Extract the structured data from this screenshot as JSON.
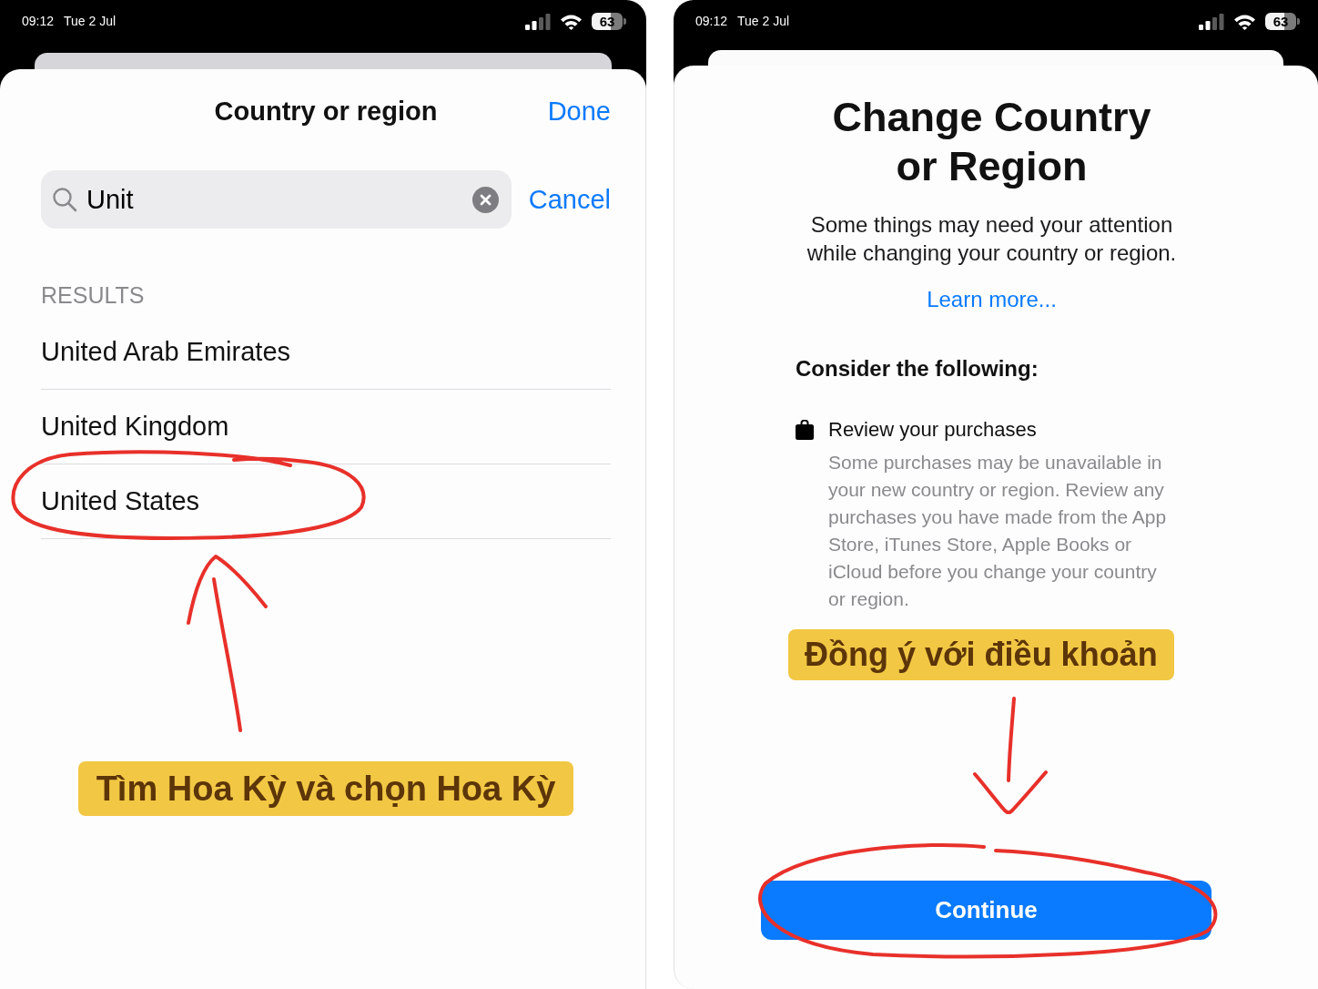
{
  "left_screen": {
    "status_bar": {
      "time": "09:12",
      "date": "Tue 2 Jul",
      "battery": "63"
    },
    "header": {
      "title": "Country or region",
      "done": "Done"
    },
    "search": {
      "value": "Unit",
      "cancel": "Cancel"
    },
    "section_header": "RESULTS",
    "results": [
      {
        "label": "United Arab Emirates",
        "circled": false
      },
      {
        "label": "United Kingdom",
        "circled": false
      },
      {
        "label": "United States",
        "circled": true
      }
    ],
    "annotation": {
      "label": "Tìm Hoa Kỳ và chọn Hoa Kỳ"
    }
  },
  "right_screen": {
    "status_bar": {
      "time": "09:12",
      "date": "Tue 2 Jul",
      "battery": "63"
    },
    "title": "Change Country or Region",
    "description": "Some things may need your attention while changing your country or region.",
    "link": "Learn more...",
    "section_heading": "Consider the following:",
    "items": [
      {
        "title": "Review your purchases",
        "body": "Some purchases may be unavailable in your new country or region. Review any purchases you have made from the App Store, iTunes Store, Apple Books or iCloud before you change your country or region."
      }
    ],
    "annotation": {
      "label": "Đồng ý với điều khoản"
    },
    "button": {
      "label": "Continue",
      "circled": true
    }
  }
}
